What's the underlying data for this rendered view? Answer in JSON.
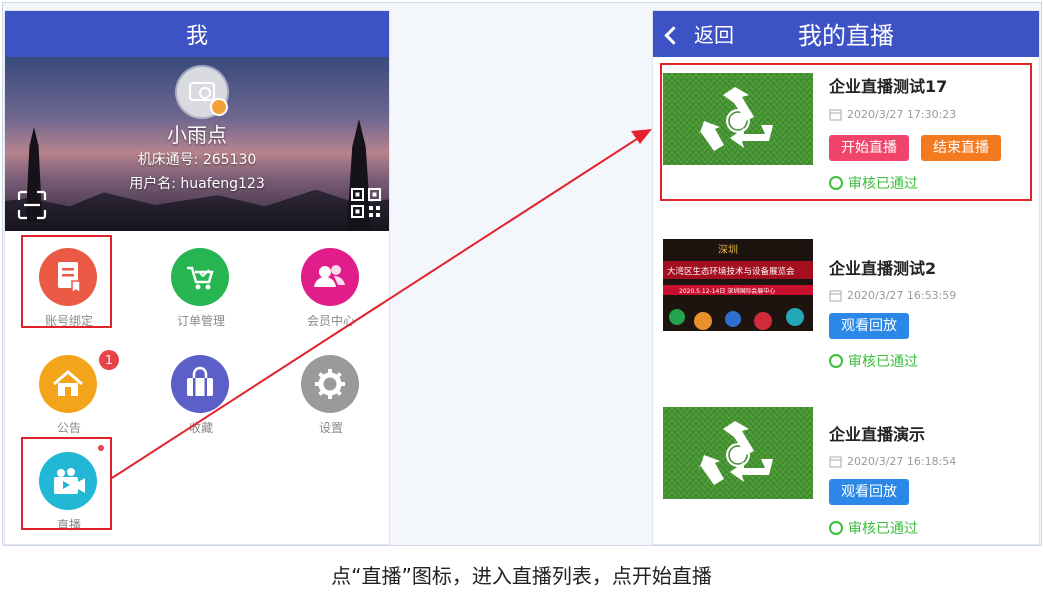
{
  "left": {
    "title": "我",
    "user": {
      "name": "小雨点",
      "machine_no": "机床通号: 265130",
      "username": "用户名: huafeng123"
    },
    "grid": [
      {
        "label": "账号绑定",
        "icon": "bookmark-doc-icon",
        "color": "#ea5a44"
      },
      {
        "label": "订单管理",
        "icon": "cart-icon",
        "color": "#27b552"
      },
      {
        "label": "会员中心",
        "icon": "members-icon",
        "color": "#e11d8b"
      },
      {
        "label": "公告",
        "icon": "house-icon",
        "color": "#f3a41b",
        "badge": "1"
      },
      {
        "label": "收藏",
        "icon": "bag-icon",
        "color": "#5b5fc7"
      },
      {
        "label": "设置",
        "icon": "gear-icon",
        "color": "#9a9a9a"
      },
      {
        "label": "直播",
        "icon": "video-camera-icon",
        "color": "#22b7d4"
      }
    ]
  },
  "right": {
    "back_label": "返回",
    "title": "我的直播",
    "items": [
      {
        "title": "企业直播测试17",
        "time": "2020/3/27 17:30:23",
        "buttons": [
          "开始直播",
          "结束直播"
        ],
        "status": "审核已通过",
        "thumb": "recycle-thumb"
      },
      {
        "title": "企业直播测试2",
        "time": "2020/3/27 16:53:59",
        "buttons": [
          "观看回放"
        ],
        "status": "审核已通过",
        "thumb": "expo-thumb",
        "thumb_text": {
          "brand": "深圳",
          "banner": "大湾区生态环境技术与设备展览会",
          "date": "2020.5.12-14日 深圳国际会展中心"
        }
      },
      {
        "title": "企业直播演示",
        "time": "2020/3/27 16:18:54",
        "buttons": [
          "观看回放"
        ],
        "status": "审核已通过",
        "thumb": "recycle-thumb"
      }
    ]
  },
  "caption": "点“直播”图标，进入直播列表，点开始直播",
  "colors": {
    "header_blue": "#3d52c5",
    "highlight_red": "#e2232b",
    "start_btn": "#f0446a",
    "end_btn": "#f47a20",
    "replay_btn": "#2b88e8",
    "approved_green": "#3cbf3c"
  }
}
